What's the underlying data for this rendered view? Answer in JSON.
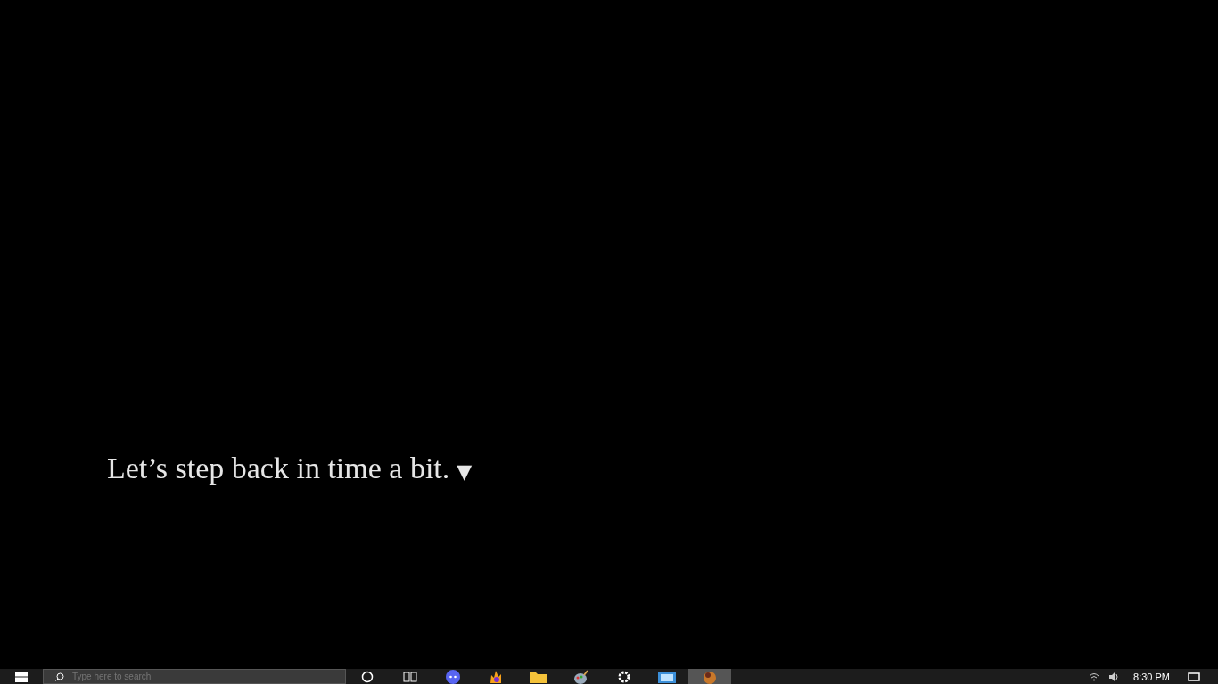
{
  "dialogue": {
    "text": "Let’s step back in time a bit.",
    "advance_marker": "▼"
  },
  "taskbar": {
    "search": {
      "placeholder": "Type here to search"
    },
    "apps": [
      {
        "kind": "cortana"
      },
      {
        "kind": "taskview"
      },
      {
        "kind": "chat"
      },
      {
        "kind": "browser"
      },
      {
        "kind": "folder"
      },
      {
        "kind": "paint"
      },
      {
        "kind": "gear"
      },
      {
        "kind": "picture"
      },
      {
        "kind": "game",
        "selected": true
      }
    ],
    "clock": "8:30 PM"
  }
}
